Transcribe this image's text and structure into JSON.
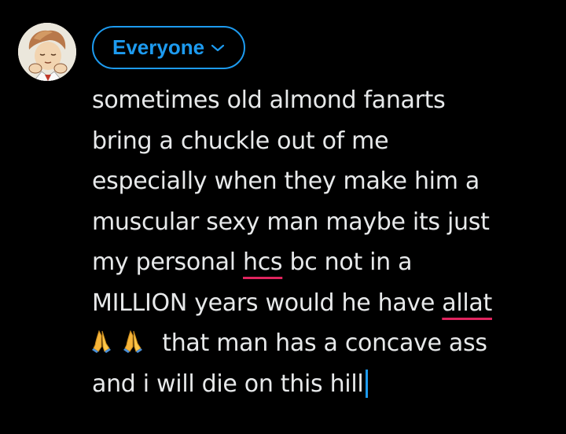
{
  "composer": {
    "audience_label": "Everyone",
    "audience_icon": "chevron-down-icon",
    "text_lines": [
      {
        "text": "sometimes old almond fanarts"
      },
      {
        "text": "bring a chuckle out of me"
      },
      {
        "text": "especially when they make him a"
      },
      {
        "text": "muscular sexy man maybe its just"
      },
      {
        "before": "my personal ",
        "flagged": "hcs",
        "after": " bc not in a"
      },
      {
        "before": "MILLION years would he have ",
        "flagged": "allat",
        "after": ""
      },
      {
        "emoji": "🙏🙏",
        "text": "that man has a concave ass"
      },
      {
        "text": "and i will die on this hill"
      }
    ],
    "accent_color": "#1d9bf0",
    "spellcheck_color": "#e0245e",
    "text_color": "#e7e9ea",
    "avatar_icon": "user-avatar-icon"
  }
}
